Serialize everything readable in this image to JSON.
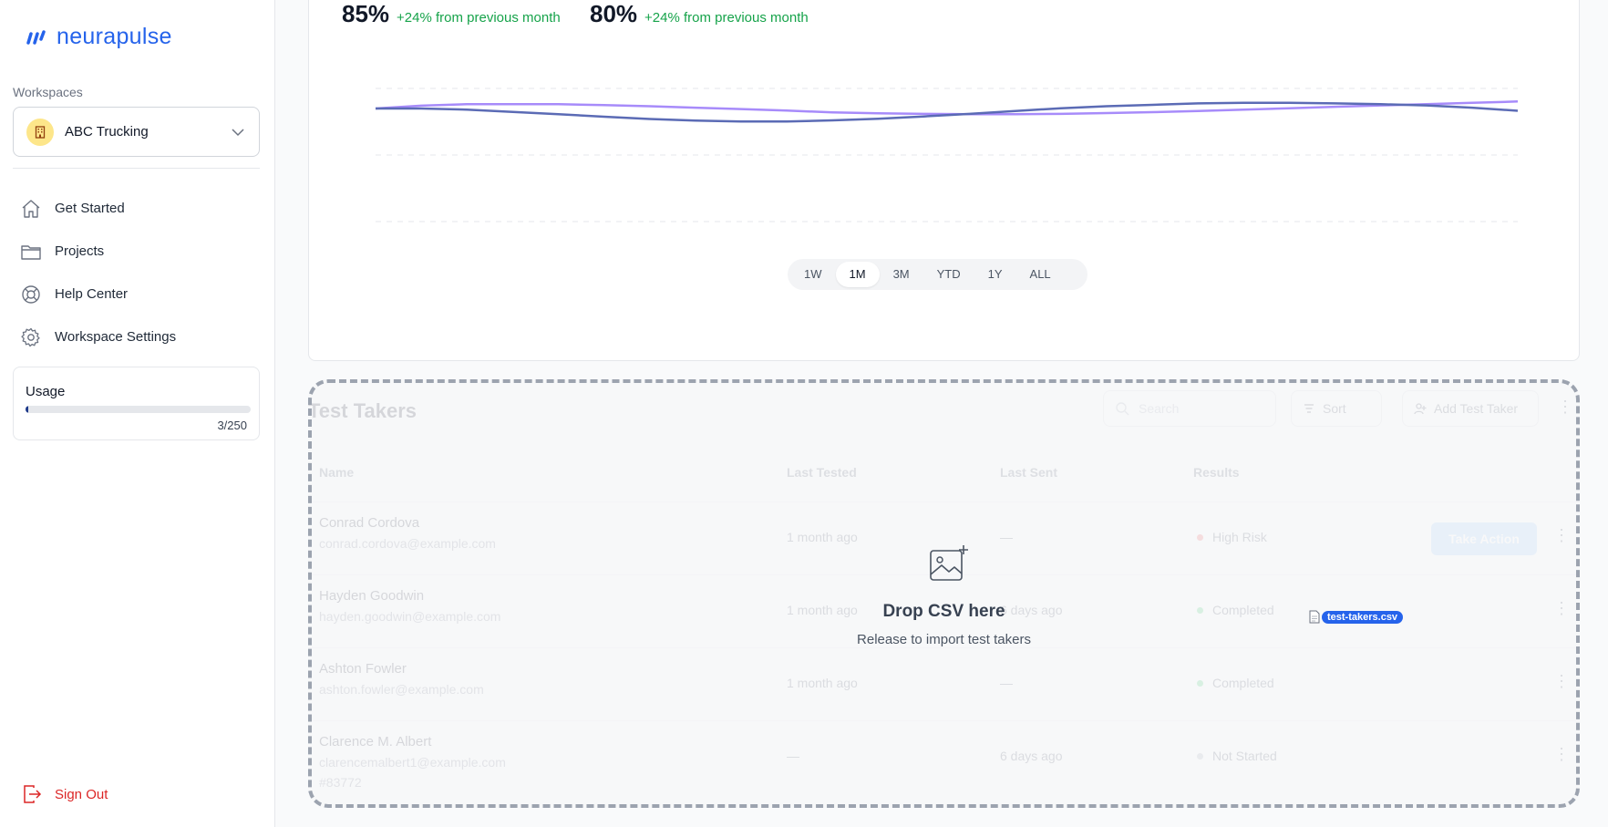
{
  "brand": {
    "name": "neurapulse",
    "color": "#2563eb"
  },
  "sidebar": {
    "workspaces_label": "Workspaces",
    "workspace": {
      "name": "ABC Trucking",
      "icon": "building-icon"
    },
    "nav": [
      {
        "label": "Get Started",
        "icon": "home-icon"
      },
      {
        "label": "Projects",
        "icon": "folder-icon"
      },
      {
        "label": "Help Center",
        "icon": "lifebuoy-icon"
      },
      {
        "label": "Workspace Settings",
        "icon": "gear-icon"
      }
    ],
    "usage": {
      "title": "Usage",
      "used": 3,
      "total": 250,
      "count_text": "3/250"
    },
    "sign_out": "Sign Out"
  },
  "metrics": [
    {
      "value": "85%",
      "change": "+24% from previous month"
    },
    {
      "value": "80%",
      "change": "+24% from previous month"
    }
  ],
  "chart_data": {
    "type": "line",
    "title": "",
    "xlabel": "",
    "ylabel": "",
    "grid": true,
    "ylim": [
      0,
      100
    ],
    "series": [
      {
        "color": "#a78bfa",
        "values": [
          85,
          86,
          86.5,
          86.5,
          86.5,
          86.2,
          85.8,
          85.3,
          84.8,
          84.3,
          83.6,
          83.3,
          83.1,
          83,
          83,
          83.1,
          83.4,
          83.7,
          84.1,
          84.6,
          85.1,
          85.6,
          86.1,
          86.5,
          87,
          87.5
        ]
      },
      {
        "color": "#5b6bb5",
        "values": [
          85,
          85,
          84.6,
          83.8,
          83,
          82.1,
          81.3,
          80.7,
          80.4,
          80.4,
          80.8,
          81.4,
          82.2,
          83.1,
          84.1,
          85.1,
          85.8,
          86.3,
          86.8,
          87,
          87,
          86.8,
          86.5,
          86.1,
          85.3,
          84.2
        ]
      }
    ]
  },
  "ranges": {
    "options": [
      "1W",
      "1M",
      "3M",
      "YTD",
      "1Y",
      "ALL"
    ],
    "selected": "1M"
  },
  "test_takers": {
    "title": "Test Takers",
    "search_placeholder": "Search",
    "sort_label": "Sort",
    "add_label": "Add Test Taker",
    "columns": [
      "Name",
      "Last Tested",
      "Last Sent",
      "Results"
    ],
    "rows": [
      {
        "name": "Conrad Cordova",
        "email": "conrad.cordova@example.com",
        "last_tested": "1 month ago",
        "last_sent": "—",
        "result": "High Risk",
        "result_color": "#ef4444",
        "action": "Take Action"
      },
      {
        "name": "Hayden Goodwin",
        "email": "hayden.goodwin@example.com",
        "last_tested": "1 month ago",
        "last_sent": "6 days ago",
        "result": "Completed",
        "result_color": "#22c55e",
        "action": ""
      },
      {
        "name": "Ashton Fowler",
        "email": "ashton.fowler@example.com",
        "last_tested": "1 month ago",
        "last_sent": "—",
        "result": "Completed",
        "result_color": "#22c55e",
        "action": ""
      },
      {
        "name": "Clarence M. Albert",
        "email": "clarencemalbert1@example.com",
        "extra": "#83772",
        "last_tested": "—",
        "last_sent": "6 days ago",
        "result": "Not Started",
        "result_color": "#9ca3af",
        "action": ""
      }
    ]
  },
  "drop": {
    "title": "Drop CSV here",
    "subtitle": "Release to import test takers",
    "icon": "image-plus-icon",
    "dragged_file": "test-takers.csv"
  }
}
